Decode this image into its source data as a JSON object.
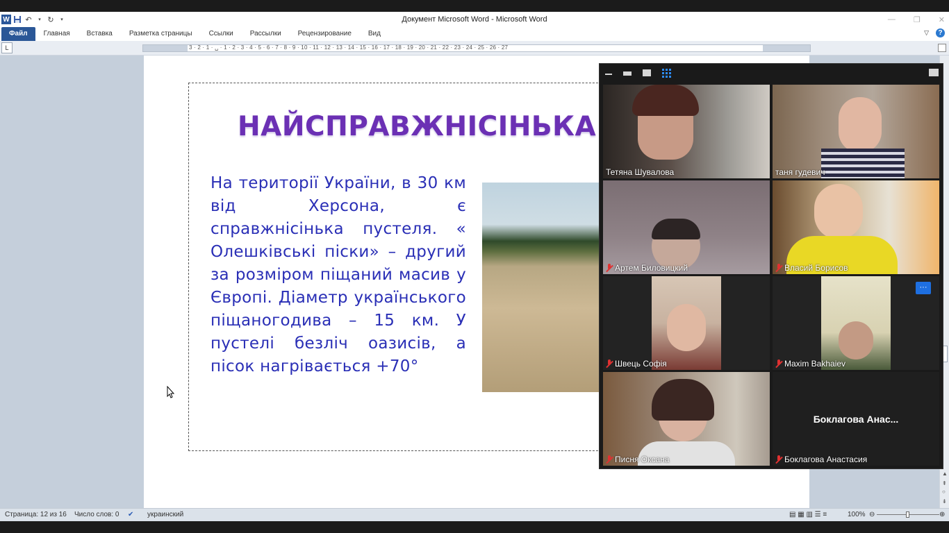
{
  "app": {
    "title": "Документ Microsoft Word - Microsoft Word",
    "word_logo": "W"
  },
  "ribbon": {
    "tabs": [
      "Файл",
      "Главная",
      "Вставка",
      "Разметка страницы",
      "Ссылки",
      "Рассылки",
      "Рецензирование",
      "Вид"
    ]
  },
  "ruler": {
    "ticks": "3 · 2 · 1 · ␣ · 1 · 2 · 3 · 4 · 5 · 6 · 7 · 8 · 9 · 10 · 11 · 12 · 13 · 14 · 15 · 16 · 17 · 18 · 19 · 20 · 21 · 22 · 23 · 24 · 25 · 26 · 27"
  },
  "slide": {
    "title": "НАЙСПРАВЖНІСІНЬКА П",
    "body": "На території України, в 30 км від Херсона, є справжнісінька пустеля. « Олешківські піски» – другий за розміром піщаний масив у Європі. Діаметр українського піщаногодива – 15 км. У пустелі безліч оазисів, а пісок нагрівається +70°"
  },
  "zoom": {
    "participants": [
      {
        "name": "Тетяна Шувалова",
        "muted": false,
        "active": true
      },
      {
        "name": "таня гудевич",
        "muted": false,
        "active": false
      },
      {
        "name": "Артем Биловицкий",
        "muted": true,
        "active": false
      },
      {
        "name": "Власий Борисов",
        "muted": true,
        "active": false
      },
      {
        "name": "Швець Софія",
        "muted": true,
        "active": false
      },
      {
        "name": "Maxim Bakhaiev",
        "muted": true,
        "active": false
      },
      {
        "name": "Писня Оксана",
        "muted": true,
        "active": false
      },
      {
        "name": "Боклагова Анастасия",
        "muted": true,
        "active": false
      }
    ],
    "truncated_name": "Боклагова  Анас...",
    "more_label": "···"
  },
  "status": {
    "page": "Страница: 12 из 16",
    "words": "Число слов: 0",
    "language": "украинский",
    "zoom": "100%"
  }
}
